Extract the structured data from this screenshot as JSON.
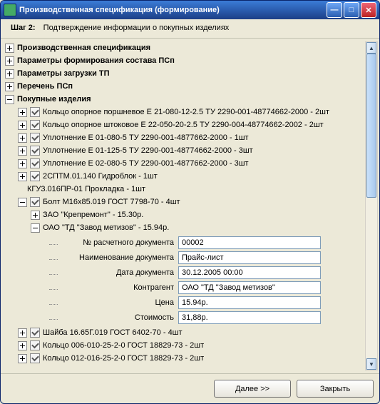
{
  "window": {
    "title": "Производственная спецификация (формирование)"
  },
  "step": {
    "label": "Шаг 2:",
    "text": "Подтверждение информации о покупных изделиях"
  },
  "sections": {
    "s0": "Производственная спецификация",
    "s1": "Параметры формирования состава ПСп",
    "s2": "Параметры загрузки ТП",
    "s3": "Перечень ПСп",
    "s4": "Покупные изделия"
  },
  "items": [
    "Кольцо опорное поршневое Е 21-080-12-2.5 ТУ 2290-001-48774662-2000 - 2шт",
    "Кольцо опорное штоковое Е 22-050-20-2.5 ТУ 2290-004-48774662-2002 - 2шт",
    "Уплотнение Е 01-080-5 ТУ 2290-001-4877662-2000 - 1шт",
    "Уплотнение Е 01-125-5 ТУ 2290-001-48774662-2000 - 3шт",
    "Уплотнение Е 02-080-5 ТУ 2290-001-4877662-2000 - 3шт",
    "2СПТМ.01.140 Гидроблок - 1шт",
    "КГУ3.016ПР-01 Прокладка - 1шт",
    "Болт М16х85.019 ГОСТ 7798-70 - 4шт",
    "Шайба 16.65Г.019 ГОСТ 6402-70 - 4шт",
    "Кольцо 006-010-25-2-0 ГОСТ 18829-73 - 2шт",
    "Кольцо 012-016-25-2-0 ГОСТ 18829-73 - 2шт"
  ],
  "bolt_suppliers": {
    "a": "ЗАО \"Крепремонт\" - 15.30р.",
    "b": "ОАО \"ТД \"Завод метизов\" - 15.94р."
  },
  "details": {
    "f0": {
      "label": "№ расчетного документа",
      "value": "00002"
    },
    "f1": {
      "label": "Наименование документа",
      "value": "Прайс-лист"
    },
    "f2": {
      "label": "Дата документа",
      "value": "30.12.2005 00:00"
    },
    "f3": {
      "label": "Контрагент",
      "value": "ОАО \"ТД \"Завод метизов\""
    },
    "f4": {
      "label": "Цена",
      "value": "15.94р."
    },
    "f5": {
      "label": "Стоимость",
      "value": "31,88р."
    }
  },
  "footer": {
    "next": "Далее  >>",
    "close": "Закрыть"
  },
  "tb": {
    "min": "—",
    "max": "□",
    "close": "✕"
  }
}
